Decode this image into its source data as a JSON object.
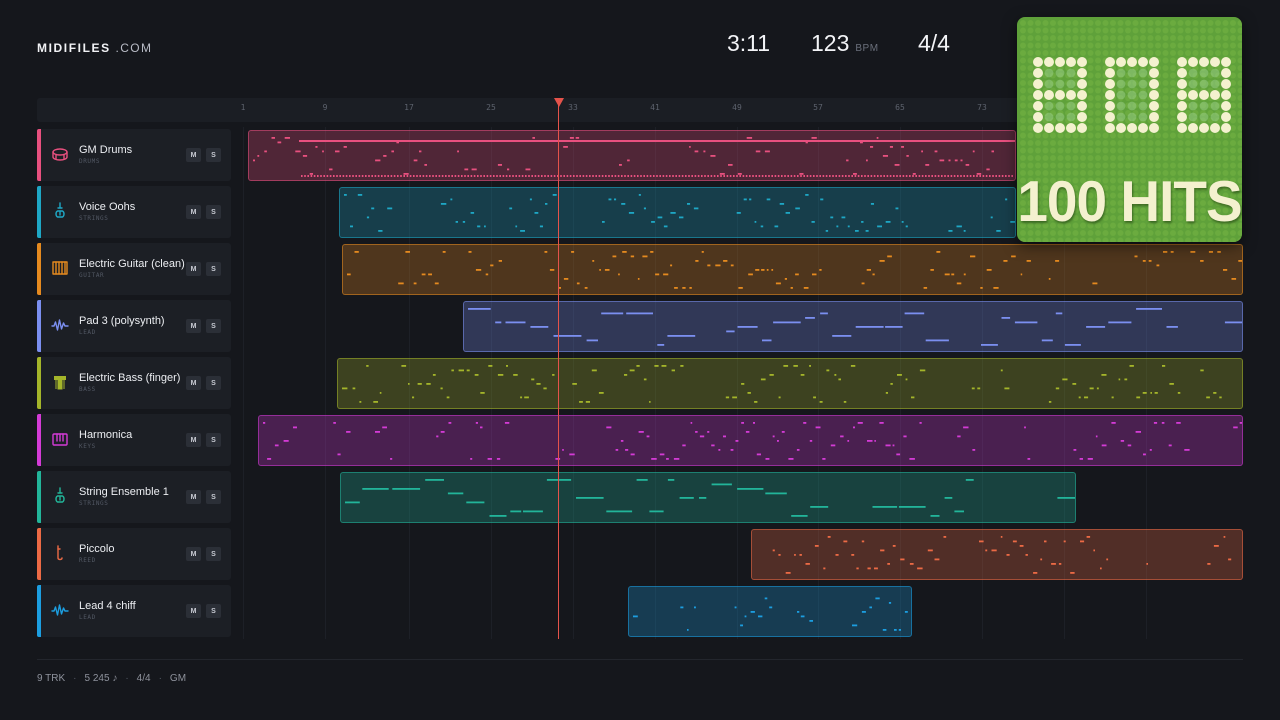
{
  "brand": {
    "name": "MIDIFILES",
    "suffix": ".COM"
  },
  "transport": {
    "time": "3:11",
    "tempo": "123",
    "tempo_unit": "BPM",
    "time_signature": "4/4"
  },
  "ruler": {
    "bar_numbers": [
      "1",
      "9",
      "17",
      "25",
      "33",
      "41",
      "49",
      "57",
      "65",
      "73"
    ]
  },
  "tracks": [
    {
      "name": "GM Drums",
      "category": "DRUMS",
      "icon": "drum-icon",
      "color": "#e8507f",
      "mute": "M",
      "solo": "S"
    },
    {
      "name": "Voice Oohs",
      "category": "STRINGS",
      "icon": "violin-icon",
      "color": "#1ea7c5",
      "mute": "M",
      "solo": "S"
    },
    {
      "name": "Electric Guitar (clean)",
      "category": "GUITAR",
      "icon": "guitar-icon",
      "color": "#e58a1f",
      "mute": "M",
      "solo": "S"
    },
    {
      "name": "Pad 3 (polysynth)",
      "category": "LEAD",
      "icon": "waveform-icon",
      "color": "#7b8ff0",
      "mute": "M",
      "solo": "S"
    },
    {
      "name": "Electric Bass (finger)",
      "category": "BASS",
      "icon": "bass-icon",
      "color": "#a4b52a",
      "mute": "M",
      "solo": "S"
    },
    {
      "name": "Harmonica",
      "category": "KEYS",
      "icon": "keyboard-icon",
      "color": "#d43bd6",
      "mute": "M",
      "solo": "S"
    },
    {
      "name": "String Ensemble 1",
      "category": "STRINGS",
      "icon": "violin-icon",
      "color": "#22b59a",
      "mute": "M",
      "solo": "S"
    },
    {
      "name": "Piccolo",
      "category": "REED",
      "icon": "reed-icon",
      "color": "#ec6a45",
      "mute": "M",
      "solo": "S"
    },
    {
      "name": "Lead 4 chiff",
      "category": "LEAD",
      "icon": "waveform-icon",
      "color": "#1c9ee0",
      "mute": "M",
      "solo": "S"
    }
  ],
  "footer": {
    "tracks": "9 TRK",
    "notes": "5 245 ♪",
    "meter": "4/4",
    "standard": "GM"
  },
  "album": {
    "title_digits": "808",
    "subtitle": "100 HITS",
    "bg_color": "#5fa13a",
    "text_color": "#f4f1cf"
  }
}
